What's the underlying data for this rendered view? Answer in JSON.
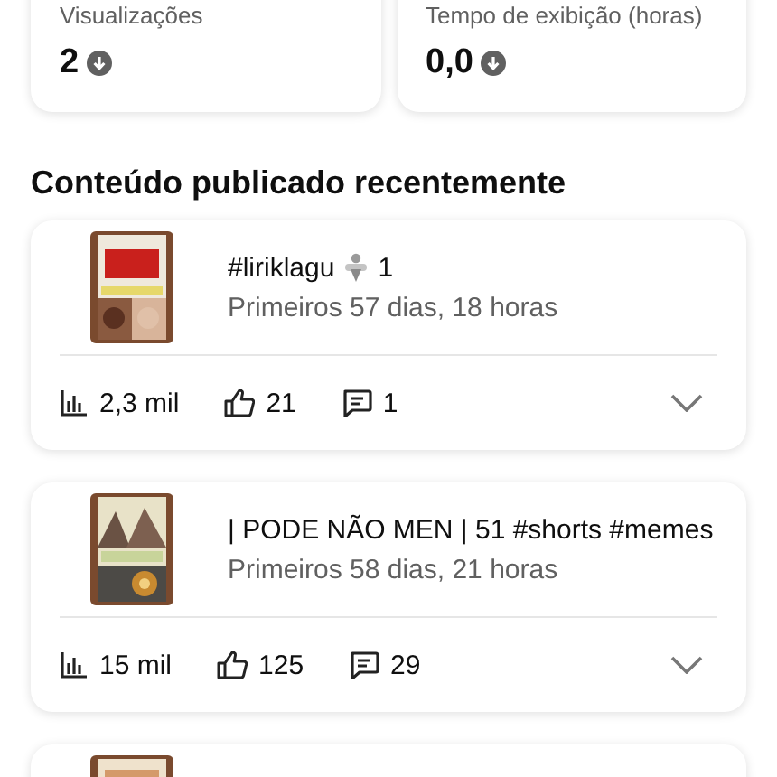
{
  "stats": [
    {
      "label": "Visualizações",
      "value": "2"
    },
    {
      "label": "Tempo de exibição (horas)",
      "value": "0,0"
    }
  ],
  "section_title": "Conteúdo publicado recentemente",
  "videos": [
    {
      "thumbnail": {
        "kind": "picture"
      },
      "title_parts": [
        {
          "kind": "text",
          "text": "#liriklagu"
        },
        {
          "kind": "emoji"
        },
        {
          "kind": "text",
          "text": "1"
        }
      ],
      "period": "Primeiros 57 dias, 18 horas",
      "views": "2,3 mil",
      "likes": "21",
      "comments": "1",
      "expanded": false
    },
    {
      "thumbnail": {
        "kind": "picture"
      },
      "title_parts": [
        {
          "kind": "text",
          "text": "| PODE NÃO MEN | 51 #shorts #memes"
        }
      ],
      "period": "Primeiros 58 dias, 21 horas",
      "views": "15 mil",
      "likes": "125",
      "comments": "29",
      "expanded": false
    },
    {
      "thumbnail": {
        "kind": "picture"
      }
    }
  ]
}
